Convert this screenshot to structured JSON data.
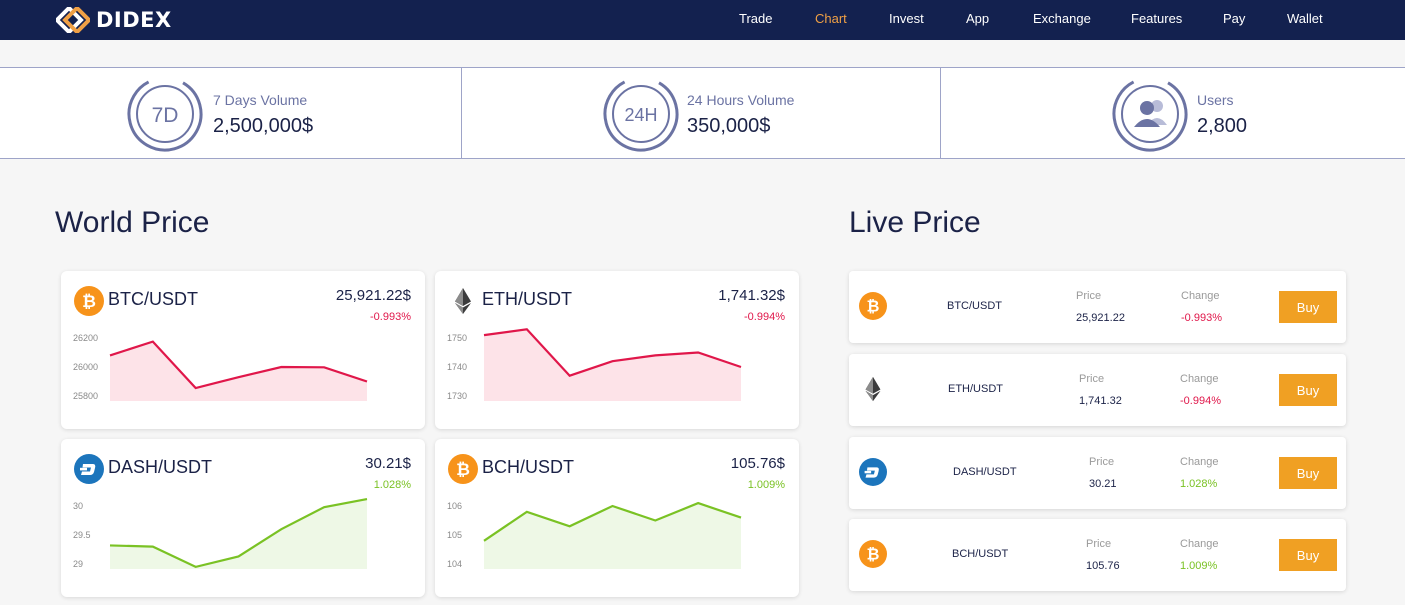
{
  "header": {
    "logo_text": "DIDEX",
    "nav": [
      {
        "label": "Trade",
        "active": false
      },
      {
        "label": "Chart",
        "active": true
      },
      {
        "label": "Invest",
        "active": false
      },
      {
        "label": "App",
        "active": false
      },
      {
        "label": "Exchange",
        "active": false
      },
      {
        "label": "Features",
        "active": false
      },
      {
        "label": "Pay",
        "active": false
      },
      {
        "label": "Wallet",
        "active": false
      }
    ]
  },
  "stats": [
    {
      "badge": "7D",
      "label": "7 Days Volume",
      "value": "2,500,000$"
    },
    {
      "badge": "24H",
      "label": "24 Hours Volume",
      "value": "350,000$"
    },
    {
      "badge": "users-icon",
      "label": "Users",
      "value": "2,800"
    }
  ],
  "world_price": {
    "title": "World Price",
    "cards": [
      {
        "pair": "BTC/USDT",
        "icon": "bitcoin-icon",
        "price": "25,921.22$",
        "change": "-0.993%",
        "trend": "down",
        "yticks": [
          "26200",
          "26000",
          "25800"
        ],
        "ylim": [
          25800,
          26200
        ],
        "values": [
          26080,
          26175,
          25855,
          25930,
          26000,
          25998,
          25900
        ]
      },
      {
        "pair": "ETH/USDT",
        "icon": "ethereum-icon",
        "price": "1,741.32$",
        "change": "-0.994%",
        "trend": "down",
        "yticks": [
          "1750",
          "1740",
          "1730"
        ],
        "ylim": [
          1730,
          1750
        ],
        "values": [
          1751,
          1753,
          1737,
          1742,
          1744,
          1745,
          1740
        ]
      },
      {
        "pair": "DASH/USDT",
        "icon": "dash-icon",
        "price": "30.21$",
        "change": "1.028%",
        "trend": "up",
        "yticks": [
          "30",
          "29.5",
          "29"
        ],
        "ylim": [
          29,
          30
        ],
        "values": [
          29.32,
          29.3,
          28.95,
          29.13,
          29.6,
          29.98,
          30.12
        ]
      },
      {
        "pair": "BCH/USDT",
        "icon": "bitcoin-icon",
        "price": "105.76$",
        "change": "1.009%",
        "trend": "up",
        "yticks": [
          "106",
          "105",
          "104"
        ],
        "ylim": [
          104,
          106
        ],
        "values": [
          104.8,
          105.8,
          105.3,
          106.0,
          105.5,
          106.1,
          105.6
        ]
      }
    ]
  },
  "live_price": {
    "title": "Live Price",
    "price_label": "Price",
    "change_label": "Change",
    "buy_label": "Buy",
    "rows": [
      {
        "pair": "BTC/USDT",
        "icon": "bitcoin-icon",
        "price": "25,921.22",
        "change": "-0.993%",
        "trend": "down"
      },
      {
        "pair": "ETH/USDT",
        "icon": "ethereum-icon",
        "price": "1,741.32",
        "change": "-0.994%",
        "trend": "down"
      },
      {
        "pair": "DASH/USDT",
        "icon": "dash-icon",
        "price": "30.21",
        "change": "1.028%",
        "trend": "up"
      },
      {
        "pair": "BCH/USDT",
        "icon": "bitcoin-icon",
        "price": "105.76",
        "change": "1.009%",
        "trend": "up"
      }
    ]
  },
  "colors": {
    "header_bg": "#13214f",
    "accent": "#f0a045",
    "negative": "#e0174a",
    "positive": "#7ac224",
    "negative_fill": "#fde3e8",
    "positive_fill": "#eef8e6",
    "buy_button": "#f0a023",
    "ring": "#6b73a3"
  }
}
